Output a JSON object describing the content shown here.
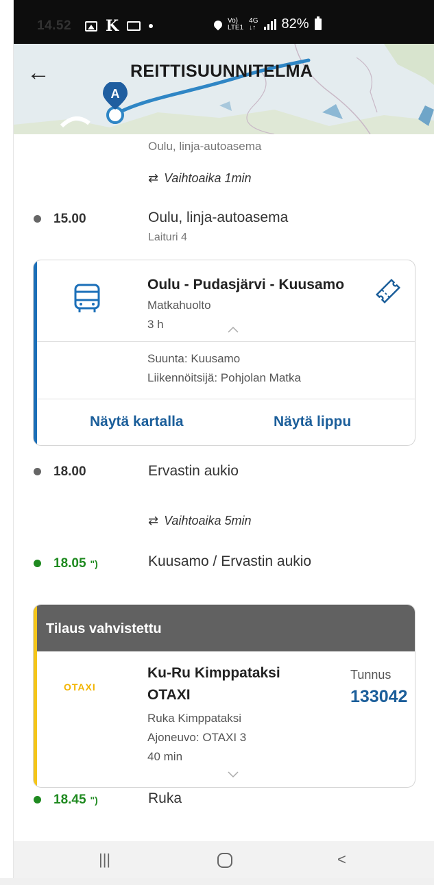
{
  "status_bar": {
    "time": "14.52",
    "k_label": "K",
    "lte_top": "Vo)",
    "lte_bottom": "LTE1",
    "net_top": "4G",
    "net_bottom": "↓↑",
    "battery": "82%"
  },
  "header": {
    "title": "REITTISUUNNITELMA",
    "marker_label": "A",
    "back_icon": "arrow-left-icon"
  },
  "timeline": {
    "prev_stop": {
      "name": "Oulu, linja-autoasema"
    },
    "transfer1": {
      "icon": "⇄",
      "text": "Vaihtoaika 1min"
    },
    "stop1": {
      "time": "15.00",
      "name": "Oulu, linja-autoasema",
      "sub": "Laituri 4"
    },
    "bus_card": {
      "title": "Oulu - Pudasjärvi - Kuusamo",
      "operator": "Matkahuolto",
      "duration": "3 h",
      "direction": "Suunta: Kuusamo",
      "carrier": "Liikennöitsijä: Pohjolan Matka",
      "show_map": "Näytä kartalla",
      "show_ticket": "Näytä lippu",
      "accent": "#1b6fb8"
    },
    "stop2": {
      "time": "18.00",
      "name": "Ervastin aukio"
    },
    "transfer2": {
      "icon": "⇄",
      "text": "Vaihtoaika 5min"
    },
    "stop3": {
      "time": "18.05",
      "name": "Kuusamo / Ervastin aukio",
      "realtime_icon": "realtime-signal-icon"
    },
    "taxi_card": {
      "status": "Tilaus vahvistettu",
      "logo_text": "OTAXI",
      "title_line1": "Ku-Ru Kimppataksi",
      "title_line2": "OTAXI",
      "service": "Ruka Kimppataksi",
      "vehicle": "Ajoneuvo: OTAXI 3",
      "duration": "40 min",
      "code_label": "Tunnus",
      "code": "133042",
      "accent": "#f5c518"
    },
    "stop4": {
      "time": "18.45",
      "name": "Ruka"
    }
  },
  "nav_bar": {
    "recents": "|||",
    "home": "○",
    "back": "<"
  },
  "colors": {
    "green": "#1f8a20",
    "link_blue": "#1b5e9a",
    "header_gray": "#616161"
  }
}
